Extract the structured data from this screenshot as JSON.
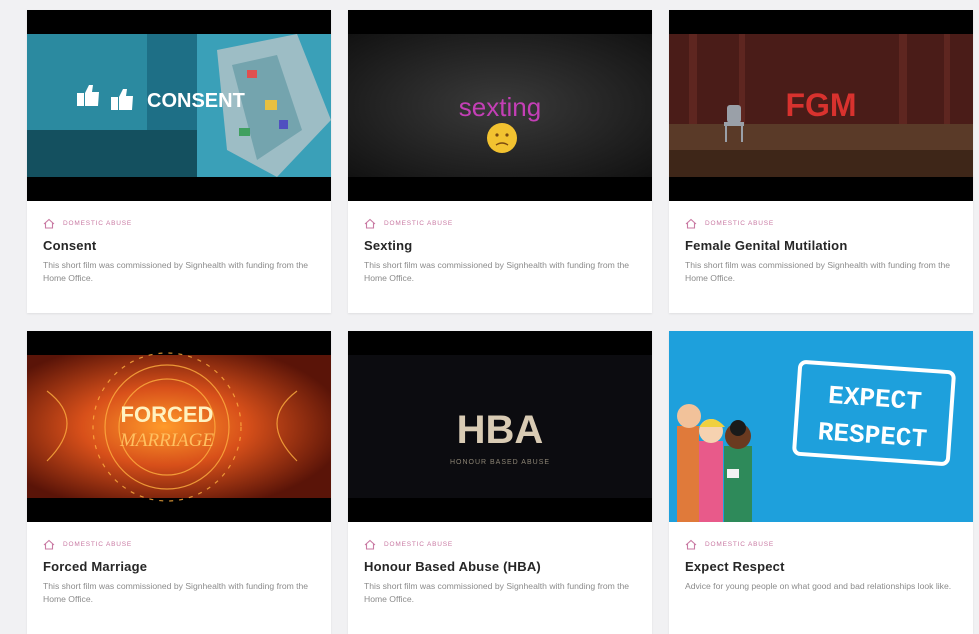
{
  "colors": {
    "accent": "#c97aa3",
    "card_bg": "#ffffff",
    "page_bg": "#f1f1f3"
  },
  "cards": [
    {
      "category": "DOMESTIC ABUSE",
      "title": "Consent",
      "description": "This short film was commissioned by Signhealth with funding from the Home Office.",
      "thumb_text": "CONSENT",
      "thumb_icon": "thumbs-up-icon"
    },
    {
      "category": "DOMESTIC ABUSE",
      "title": "Sexting",
      "description": "This short film was commissioned by Signhealth with funding from the Home Office.",
      "thumb_text": "sexting",
      "thumb_icon": "sad-face-emoji-icon"
    },
    {
      "category": "DOMESTIC ABUSE",
      "title": "Female Genital Mutilation",
      "description": "This short film was commissioned by Signhealth with funding from the Home Office.",
      "thumb_text": "FGM",
      "thumb_icon": "chair-icon"
    },
    {
      "category": "DOMESTIC ABUSE",
      "title": "Forced Marriage",
      "description": "This short film was commissioned by Signhealth with funding from the Home Office.",
      "thumb_text": "FORCED",
      "thumb_text_2": "MARRIAGE",
      "thumb_icon": "mandala-icon"
    },
    {
      "category": "DOMESTIC ABUSE",
      "title": "Honour Based Abuse (HBA)",
      "description": "This short film was commissioned by Signhealth with funding from the Home Office.",
      "thumb_text": "HBA",
      "thumb_text_2": "HONOUR BASED ABUSE"
    },
    {
      "category": "DOMESTIC ABUSE",
      "title": "Expect Respect",
      "description": "Advice for young people on what good and bad relationships look like.",
      "thumb_text": "EXPECT",
      "thumb_text_2": "RESPECT",
      "thumb_icon": "cartoon-people-icon"
    }
  ]
}
